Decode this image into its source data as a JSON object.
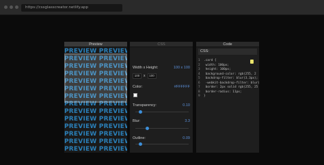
{
  "browser": {
    "url": "https://cssglasscreator.netlify.app"
  },
  "preview": {
    "title": "Preview",
    "text_lines": [
      "PREVIEW PREVIEW PREVIEW",
      "PREVIEW PREVIEW PREVIEW",
      "PREVIEW PREVIEW PREVIEW",
      "PREVIEW PREVIEW PREVIEW",
      "PREVIEW PREVIEW PREVIEW",
      "PREVIEW PREVIEW PREVIEW",
      "PREVIEW PREVIEW PREVIEW",
      "PREVIEW PREVIEW PREVIEW",
      "PREVIEW PREVIEW PREVIEW",
      "PREVIEW PREVIEW PREVIEW",
      "PREVIEW PREVIEW PREVIEW",
      "PREVIEW PREVIEW PREVIEW",
      "PREVIEW PREVIEW PREVIEW",
      "PREVIEW PREVIEW PREVIEW"
    ],
    "text_color": "#2a7fb8"
  },
  "controls": {
    "size_label": "Width x Height:",
    "size_value": "100 x 100",
    "width": "100",
    "height": "100",
    "x_sep": "x",
    "color_label": "Color:",
    "color_value": "#FFFFFF",
    "transparency_label": "Transparency:",
    "transparency_value": "0.10",
    "blur_label": "Blur:",
    "blur_value": "3.3",
    "outline_label": "Outline:",
    "outline_value": "0.09",
    "transparency_level": 0.1,
    "blur_level": 0.22,
    "outline_level": 0.09
  },
  "code": {
    "title": "Code",
    "css_label": "CSS:",
    "lines": [
      {
        "n": "1",
        "t": ".card {"
      },
      {
        "n": "2",
        "t": "  width: 100px;"
      },
      {
        "n": "3",
        "t": "  height: 100px;"
      },
      {
        "n": "4",
        "t": "  background-color: rgb(255, 2"
      },
      {
        "n": "5",
        "t": "  backdrop-filter: blur(3.3px);"
      },
      {
        "n": "6",
        "t": "  -webkit-backdrop-filter: blur("
      },
      {
        "n": "7",
        "t": "  border: 2px solid rgb(255, 25"
      },
      {
        "n": "8",
        "t": "  border-radius: 11px;"
      },
      {
        "n": "9",
        "t": "}"
      }
    ]
  },
  "colors": {
    "accent": "#3d8fd9",
    "copy_icon": "#e9e36a"
  }
}
